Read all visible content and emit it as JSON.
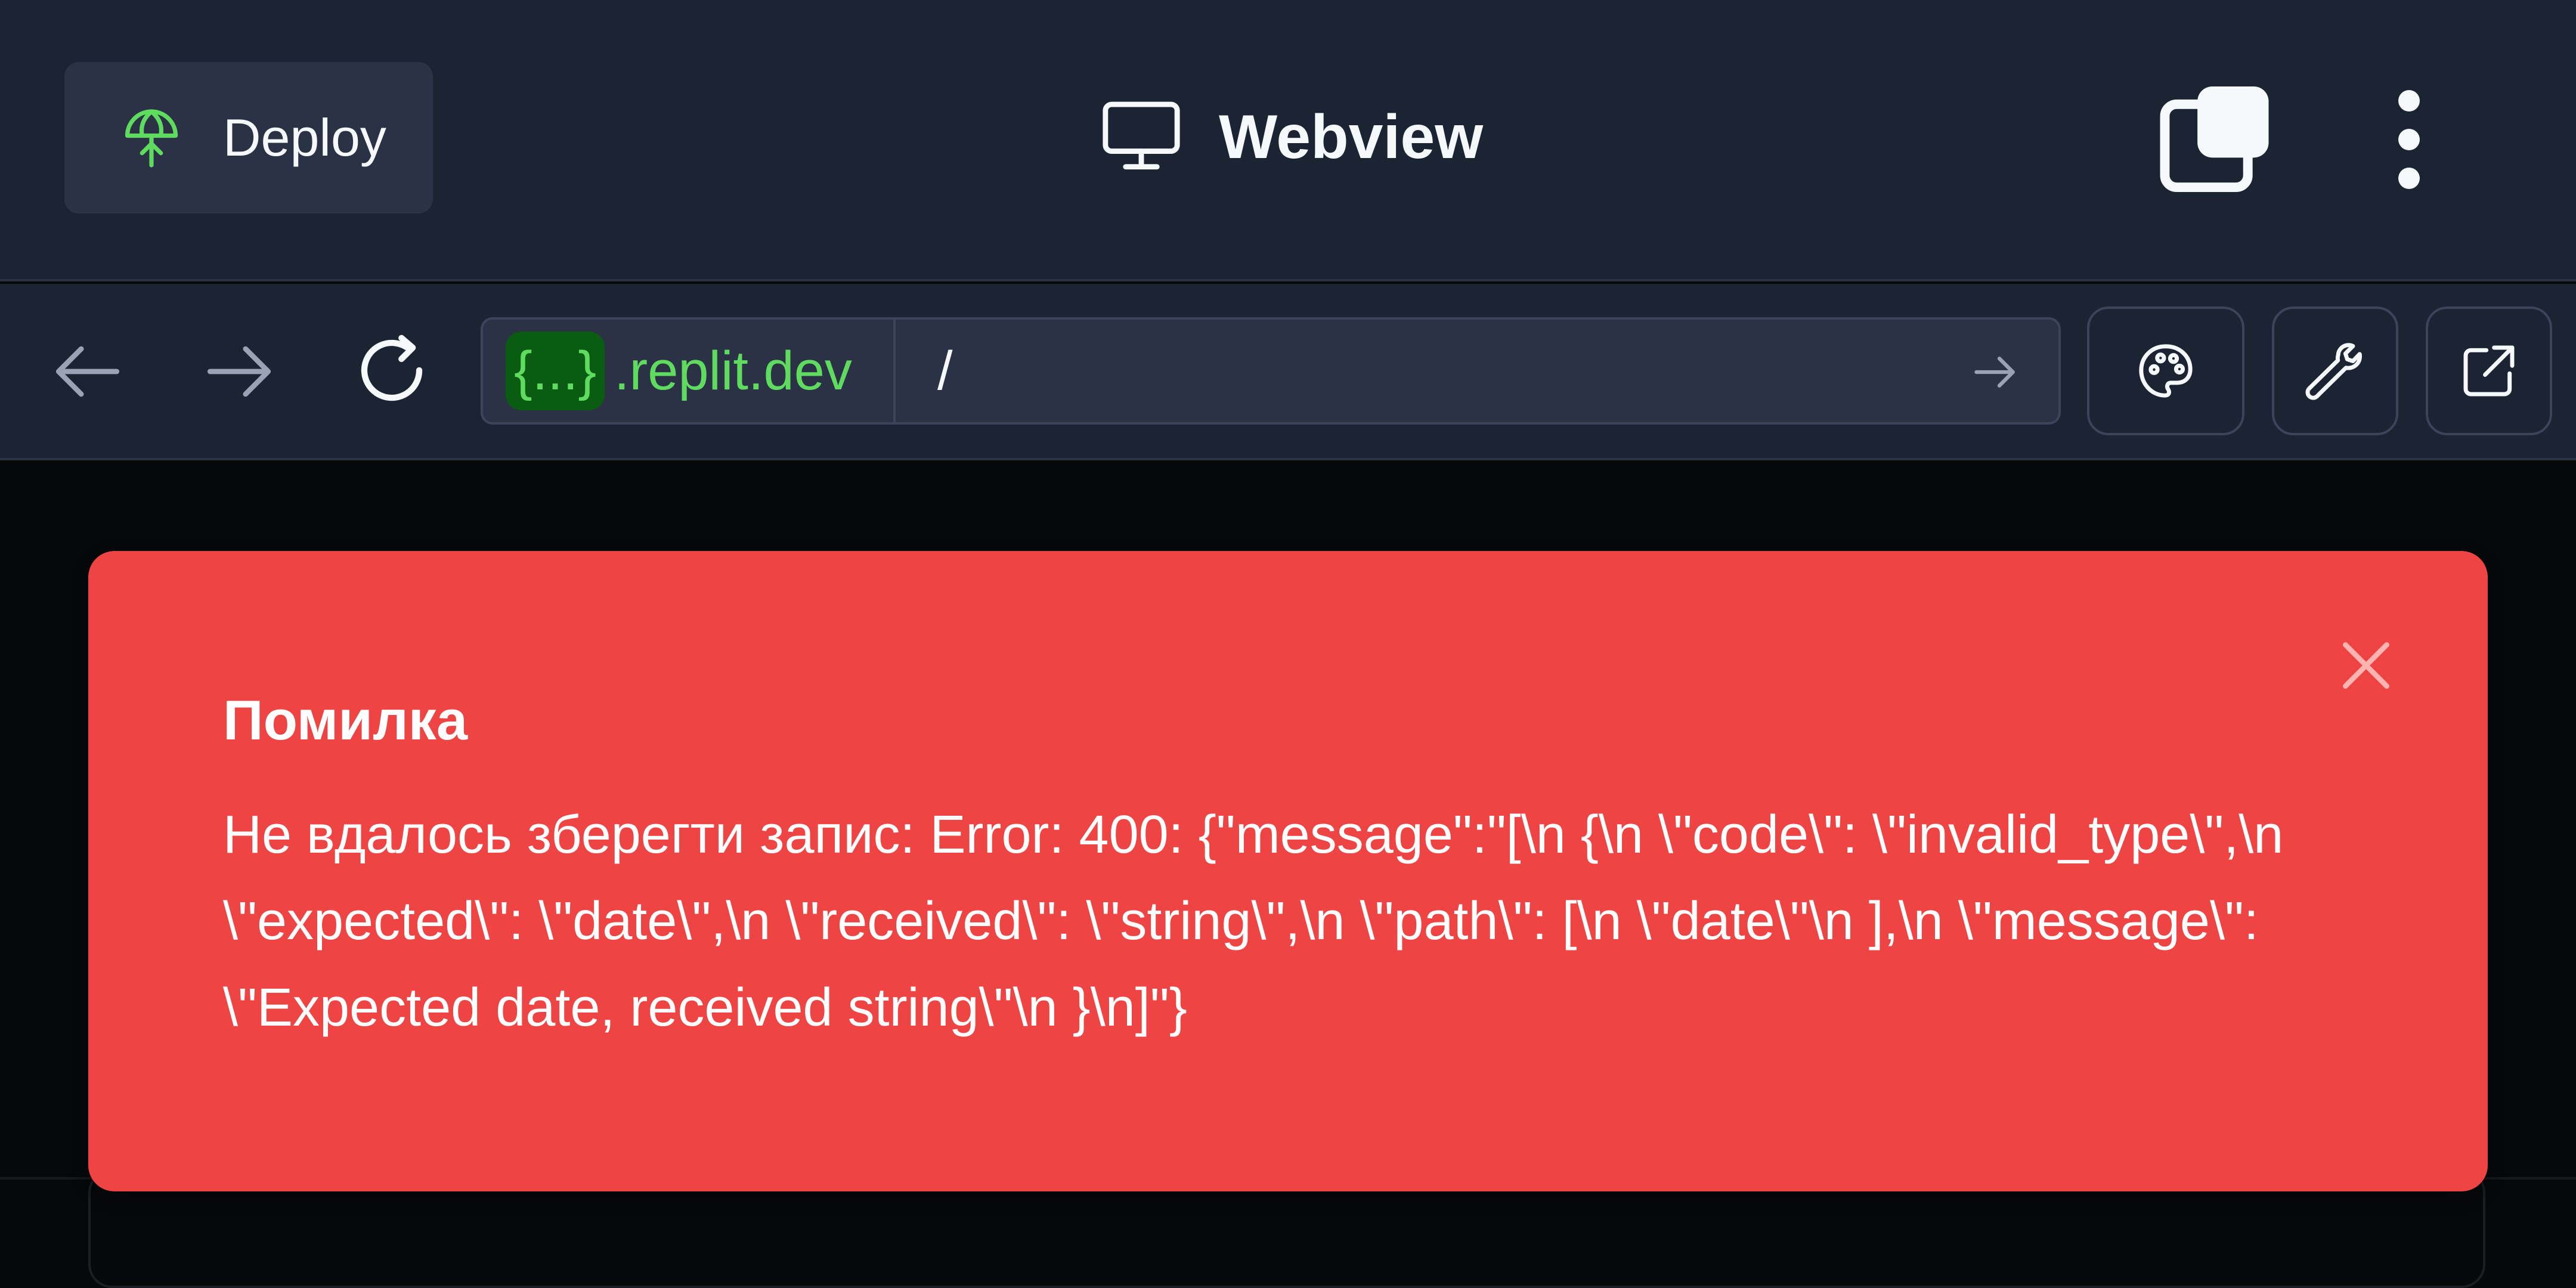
{
  "header": {
    "deploy_label": "Deploy",
    "title": "Webview",
    "deploy_icon": "deploy-icon",
    "monitor_icon": "monitor-icon",
    "tabs_icon": "tabs-icon",
    "menu_icon": "kebab-menu-icon"
  },
  "browser": {
    "back_icon": "arrow-left-icon",
    "forward_icon": "arrow-right-icon",
    "reload_icon": "reload-icon",
    "host_badge": "{...}",
    "domain": ".replit.dev",
    "path": "/",
    "go_icon": "arrow-right-icon",
    "tools": [
      "palette-icon",
      "wrench-icon",
      "external-link-icon"
    ]
  },
  "toast": {
    "title": "Помилка",
    "message": "Не вдалось зберегти запис: Error: 400: {\"message\":\"[\\n {\\n \\\"code\\\": \\\"invalid_type\\\",\\n \\\"expected\\\": \\\"date\\\",\\n \\\"received\\\": \\\"string\\\",\\n \\\"path\\\": [\\n \\\"date\\\"\\n ],\\n \\\"message\\\": \\\"Expected date, received string\\\"\\n }\\n]\"}",
    "close_icon": "close-icon"
  },
  "colors": {
    "toolbar_bg": "#1c2333",
    "button_bg": "#2b3245",
    "accent_green": "#5fdc5f",
    "error_red": "#ef4444",
    "page_bg": "#07080a"
  }
}
